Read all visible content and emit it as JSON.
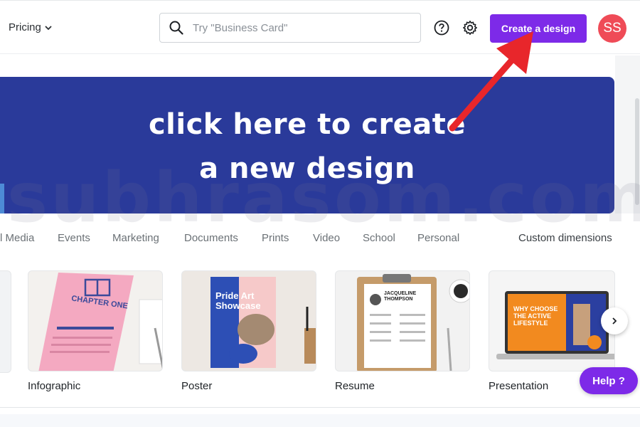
{
  "header": {
    "pricing_label": "Pricing",
    "search_placeholder": "Try \"Business Card\"",
    "create_label": "Create a design",
    "avatar_initials": "SS"
  },
  "hero": {
    "line1": "click here to create",
    "line2": "a new design"
  },
  "watermark": "subhrasom.com",
  "categories": [
    "l Media",
    "Events",
    "Marketing",
    "Documents",
    "Prints",
    "Video",
    "School",
    "Personal"
  ],
  "custom_dimensions": "Custom dimensions",
  "templates": [
    {
      "label": "Infographic",
      "thumb_title": "CHAPTER ONE"
    },
    {
      "label": "Poster",
      "thumb_title": "Pride Art Showcase"
    },
    {
      "label": "Resume",
      "thumb_title": "JACQUELINE THOMPSON"
    },
    {
      "label": "Presentation",
      "thumb_title": "WHY CHOOSE THE ACTIVE LIFESTYLE"
    }
  ],
  "help_label": "Help ?",
  "colors": {
    "brand": "#7d2ae8",
    "hero_bg": "#2a3a9a",
    "avatar": "#ef4b57",
    "arrow": "#e8262b"
  }
}
